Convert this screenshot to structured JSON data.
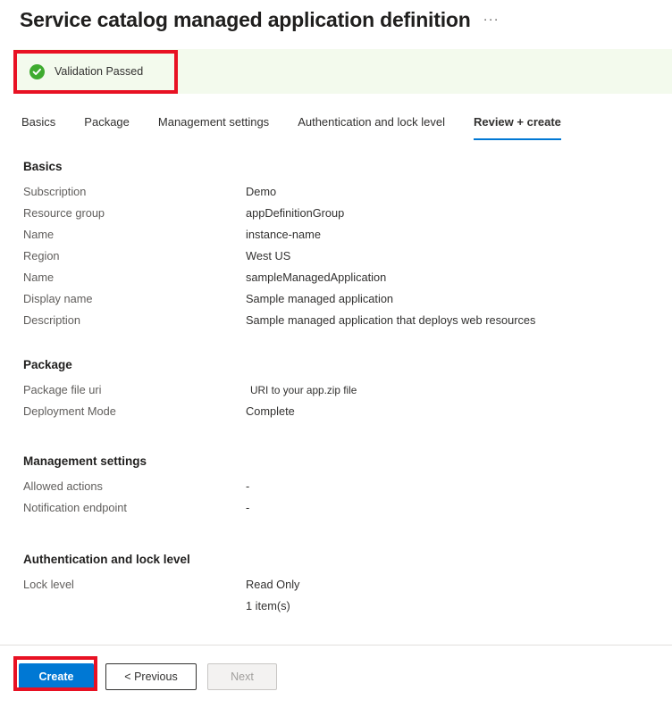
{
  "header": {
    "title": "Service catalog managed application definition",
    "more_actions": "···"
  },
  "validation": {
    "message": "Validation Passed",
    "status_color": "#3eab2f",
    "background_color": "#f3faed",
    "annotation_color": "#e81123"
  },
  "tabs": [
    {
      "label": "Basics",
      "active": false
    },
    {
      "label": "Package",
      "active": false
    },
    {
      "label": "Management settings",
      "active": false
    },
    {
      "label": "Authentication and lock level",
      "active": false
    },
    {
      "label": "Review + create",
      "active": true
    }
  ],
  "accent_color": "#0078d4",
  "sections": [
    {
      "title": "Basics",
      "rows": [
        {
          "label": "Subscription",
          "value": "Demo"
        },
        {
          "label": "Resource group",
          "value": "appDefinitionGroup"
        },
        {
          "label": "Name",
          "value": "instance-name"
        },
        {
          "label": "Region",
          "value": "West US"
        },
        {
          "label": "Name",
          "value": "sampleManagedApplication"
        },
        {
          "label": "Display name",
          "value": "Sample managed application"
        },
        {
          "label": "Description",
          "value": "Sample managed application that deploys web resources"
        }
      ]
    },
    {
      "title": "Package",
      "rows": [
        {
          "label": "Package file uri",
          "value": "URI to your app.zip file"
        },
        {
          "label": "Deployment Mode",
          "value": "Complete"
        }
      ]
    },
    {
      "title": "Management settings",
      "rows": [
        {
          "label": "Allowed actions",
          "value": "-"
        },
        {
          "label": "Notification endpoint",
          "value": "-"
        }
      ]
    },
    {
      "title": "Authentication and lock level",
      "rows": [
        {
          "label": "Lock level",
          "value": "Read Only"
        }
      ],
      "extra_value": "1 item(s)"
    }
  ],
  "footer": {
    "create_label": "Create",
    "previous_label": "< Previous",
    "next_label": "Next"
  }
}
